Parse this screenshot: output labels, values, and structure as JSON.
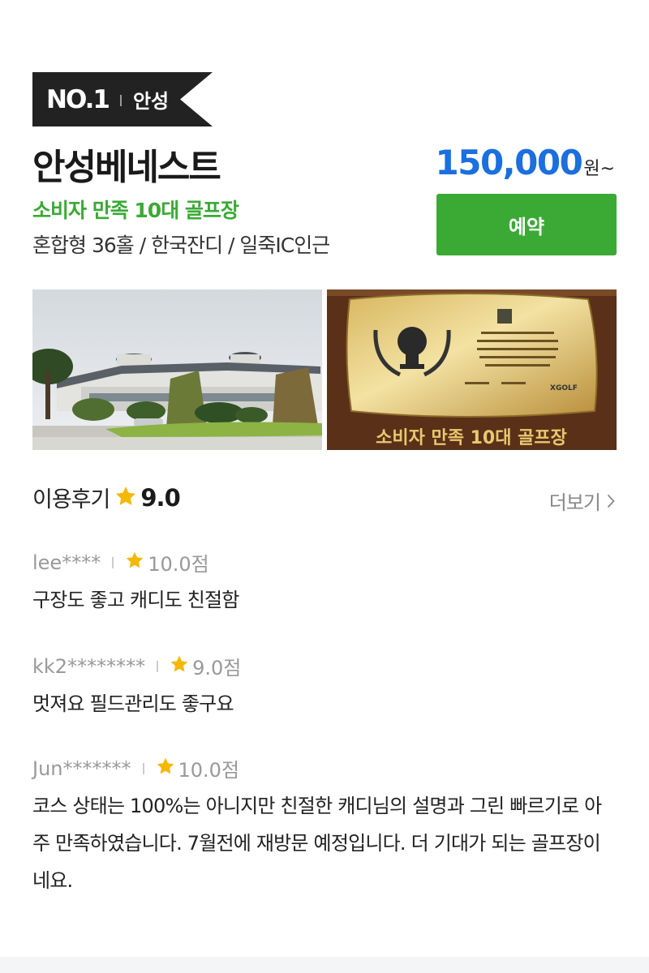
{
  "badge": {
    "rank": "NO.1",
    "region": "안성"
  },
  "course": {
    "name": "안성베네스트",
    "subtitle": "소비자 만족 10대 골프장",
    "info": "혼합형 36홀 / 한국잔디 / 일죽IC인근",
    "price": "150,000",
    "price_unit": "원~"
  },
  "reserve_button": {
    "label": "예약"
  },
  "photos": {
    "right_banner": "소비자 만족 10대 골프장",
    "plaque_brand": "XGOLF"
  },
  "reviews_section": {
    "label": "이용후기",
    "score": "9.0",
    "more_label": "더보기"
  },
  "reviews": [
    {
      "user": "lee****",
      "score": "10.0점",
      "text": "구장도 좋고 캐디도 친절함"
    },
    {
      "user": "kk2********",
      "score": "9.0점",
      "text": "멋져요 필드관리도 좋구요"
    },
    {
      "user": "Jun*******",
      "score": "10.0점",
      "text": "코스 상태는 100%는 아니지만 친절한 캐디님의 설명과 그린 빠르기로 아주 만족하였습니다. 7월전에 재방문 예정입니다. 더 기대가 되는 골프장이네요."
    }
  ],
  "colors": {
    "accent_green": "#3aaa35",
    "price_blue": "#1b6fde",
    "star": "#f5b800",
    "badge_bg": "#222222"
  }
}
